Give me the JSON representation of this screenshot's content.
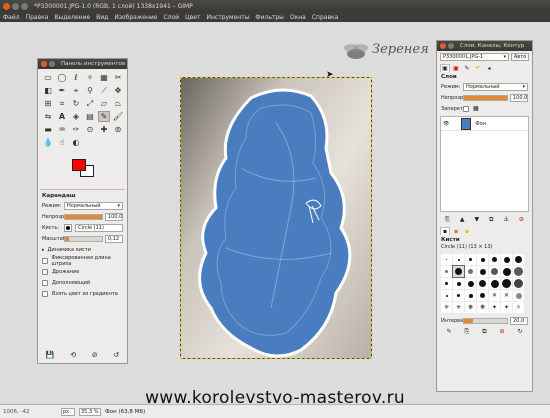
{
  "window": {
    "title": "*P3300001.JPG-1.0 (RGB, 1 слой) 1338x1941 – GIMP"
  },
  "menu": [
    "Файл",
    "Правка",
    "Выделение",
    "Вид",
    "Изображение",
    "Слой",
    "Цвет",
    "Инструменты",
    "Фильтры",
    "Окна",
    "Справка"
  ],
  "toolbox": {
    "title": "Панель инструментов",
    "tool_icons": [
      "rect-select",
      "ellipse-select",
      "free-select",
      "fuzzy-select",
      "select-by-color",
      "scissors",
      "foreground-select",
      "paths",
      "color-picker",
      "zoom",
      "measure",
      "move",
      "align",
      "crop",
      "rotate",
      "scale",
      "shear",
      "perspective",
      "flip",
      "text",
      "bucket-fill",
      "blend",
      "pencil",
      "paintbrush",
      "eraser",
      "airbrush",
      "ink",
      "clone",
      "heal",
      "perspective-clone",
      "blur",
      "smudge",
      "dodge"
    ],
    "fg_color": "#ff0000",
    "bg_color": "#ffffff",
    "options": {
      "tool_name": "Карандаш",
      "mode_label": "Режим:",
      "mode_value": "Нормальный",
      "opacity_label": "Непрозр.",
      "opacity_value": "100,0",
      "opacity_fraction": 1.0,
      "brush_label": "Кисть:",
      "brush_value": "Circle (11)",
      "scale_label": "Масштаб:",
      "scale_value": "0,12",
      "dynamics_label": "Динамика кисти",
      "checkbox_1": "Фиксированная длина штриха",
      "checkbox_2": "Дрожание",
      "checkbox_3": "Дополняющий",
      "checkbox_4": "Взять цвет из градиента"
    }
  },
  "layers_dock": {
    "title": "Слои, Каналы, Контур",
    "image_select": "P3300001.JPG-1",
    "auto_label": "Авто",
    "layers_title": "Слои",
    "mode_label": "Режим:",
    "mode_value": "Нормальный",
    "opacity_label": "Непрозр.",
    "opacity_value": "100,0",
    "lock_label": "Запереть:",
    "layer_name": "Фон",
    "brushes_title": "Кисти",
    "brushes_subtitle": "Circle (11) (13 × 13)",
    "spacing_label": "Интервал",
    "spacing_value": "20,0"
  },
  "logo_text": "Зеренея",
  "watermark": "www.korolevstvo-masterov.ru",
  "status": {
    "coords": "1006, -42",
    "unit": "px",
    "zoom": "35,3 %",
    "info": "Фон (63,8 МБ)"
  }
}
